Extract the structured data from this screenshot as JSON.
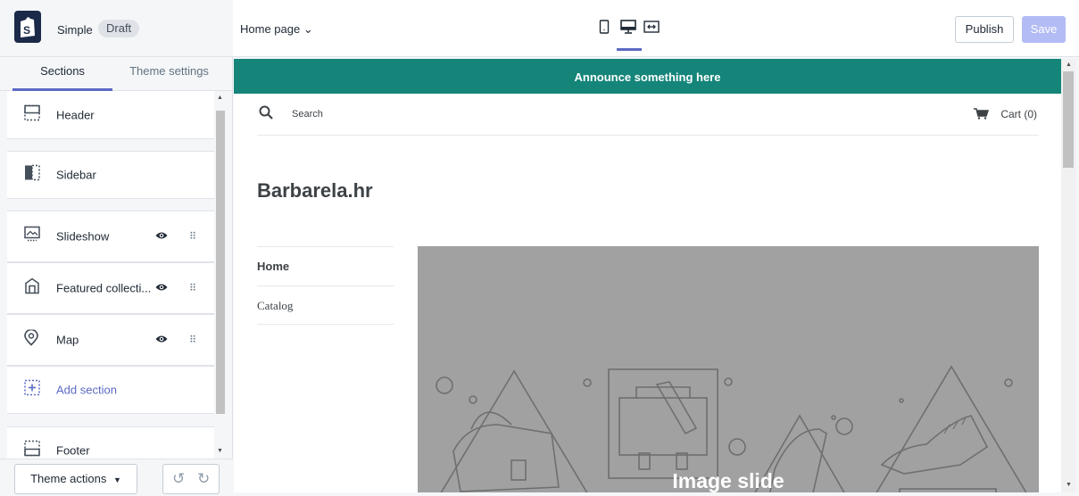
{
  "header": {
    "theme_name": "Simple",
    "status_badge": "Draft",
    "tabs": {
      "sections": "Sections",
      "theme_settings": "Theme settings"
    }
  },
  "sections": [
    {
      "label": "Header",
      "icon": "header-icon"
    },
    {
      "label": "Sidebar",
      "icon": "sidebar-icon"
    },
    {
      "label": "Slideshow",
      "icon": "slideshow-icon"
    },
    {
      "label": "Featured collecti...",
      "icon": "collection-icon"
    },
    {
      "label": "Map",
      "icon": "map-pin-icon"
    },
    {
      "label": "Add section",
      "icon": "add-section-icon"
    },
    {
      "label": "Footer",
      "icon": "footer-icon"
    }
  ],
  "footer": {
    "theme_actions": "Theme actions"
  },
  "topbar": {
    "page_select": "Home page",
    "publish": "Publish",
    "save": "Save",
    "devices": [
      "mobile-icon",
      "desktop-icon",
      "fullscreen-icon"
    ]
  },
  "preview": {
    "announcement": "Announce something here",
    "search": "Search",
    "cart": "Cart (0)",
    "store_title": "Barbarela.hr",
    "nav": [
      "Home",
      "Catalog"
    ],
    "slide_text": "Image slide"
  },
  "colors": {
    "accent": "#5c6ac4",
    "announcement_bg": "#15857a",
    "slide_bg": "#a1a1a1",
    "save_disabled": "#b3bcf5"
  }
}
